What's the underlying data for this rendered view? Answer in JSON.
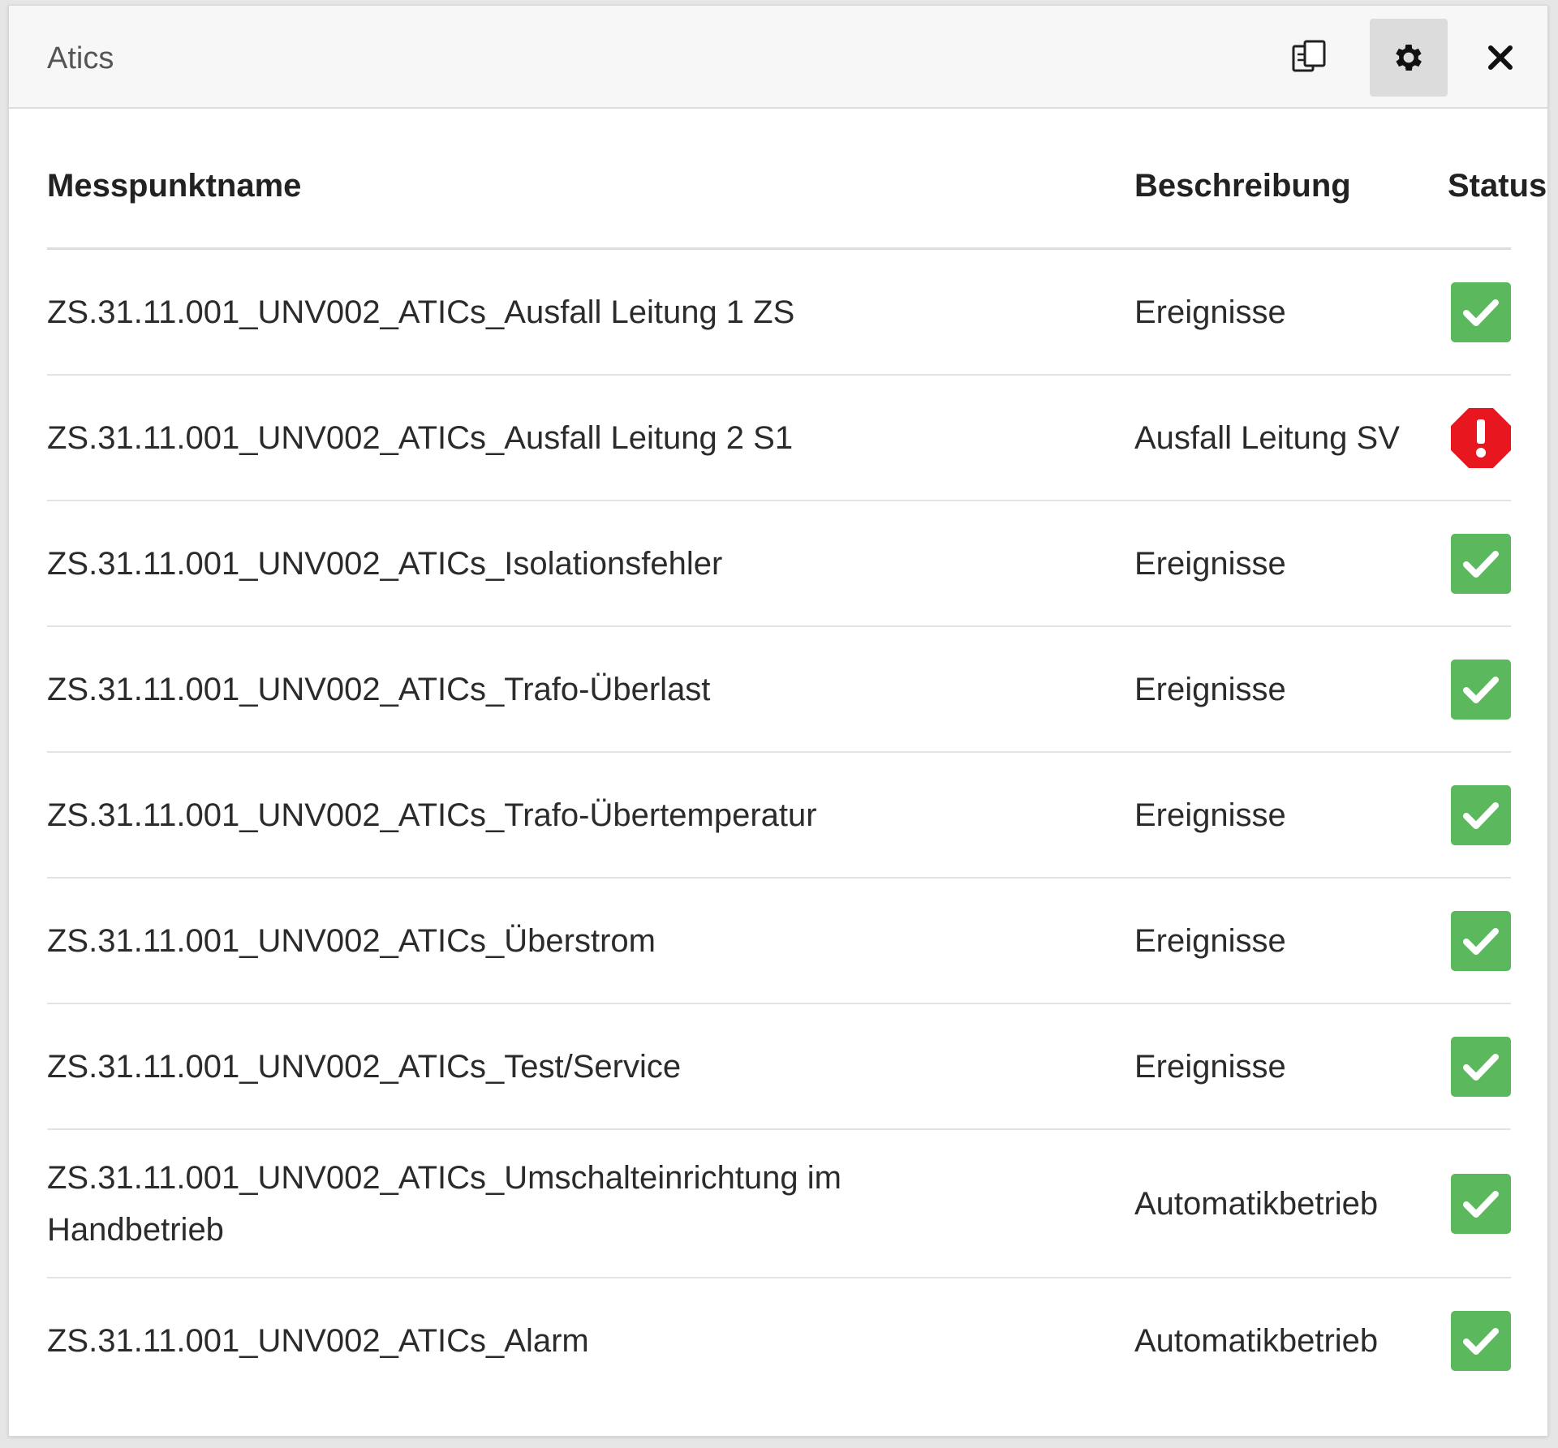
{
  "header": {
    "title": "Atics",
    "icons": {
      "copy": "copy-icon",
      "settings": "gear-icon",
      "close": "close-icon"
    }
  },
  "table": {
    "columns": [
      "Messpunktname",
      "Beschreibung",
      "Status"
    ],
    "rows": [
      {
        "name": "ZS.31.11.001_UNV002_ATICs_Ausfall Leitung 1 ZS",
        "description": "Ereignisse",
        "status": "ok"
      },
      {
        "name": "ZS.31.11.001_UNV002_ATICs_Ausfall Leitung 2 S1",
        "description": "Ausfall Leitung SV",
        "status": "alarm"
      },
      {
        "name": "ZS.31.11.001_UNV002_ATICs_Isolationsfehler",
        "description": "Ereignisse",
        "status": "ok"
      },
      {
        "name": "ZS.31.11.001_UNV002_ATICs_Trafo-Überlast",
        "description": "Ereignisse",
        "status": "ok"
      },
      {
        "name": "ZS.31.11.001_UNV002_ATICs_Trafo-Übertemperatur",
        "description": "Ereignisse",
        "status": "ok"
      },
      {
        "name": "ZS.31.11.001_UNV002_ATICs_Überstrom",
        "description": "Ereignisse",
        "status": "ok"
      },
      {
        "name": "ZS.31.11.001_UNV002_ATICs_Test/Service",
        "description": "Ereignisse",
        "status": "ok"
      },
      {
        "name": "ZS.31.11.001_UNV002_ATICs_Umschalteinrichtung im Handbetrieb",
        "description": "Automatikbetrieb",
        "status": "ok"
      },
      {
        "name": "ZS.31.11.001_UNV002_ATICs_Alarm",
        "description": "Automatikbetrieb",
        "status": "ok"
      }
    ]
  },
  "colors": {
    "ok": "#5cb85c",
    "alarm": "#e8161f",
    "header_bg": "#f7f7f7",
    "active_button_bg": "#dcdcdc"
  }
}
